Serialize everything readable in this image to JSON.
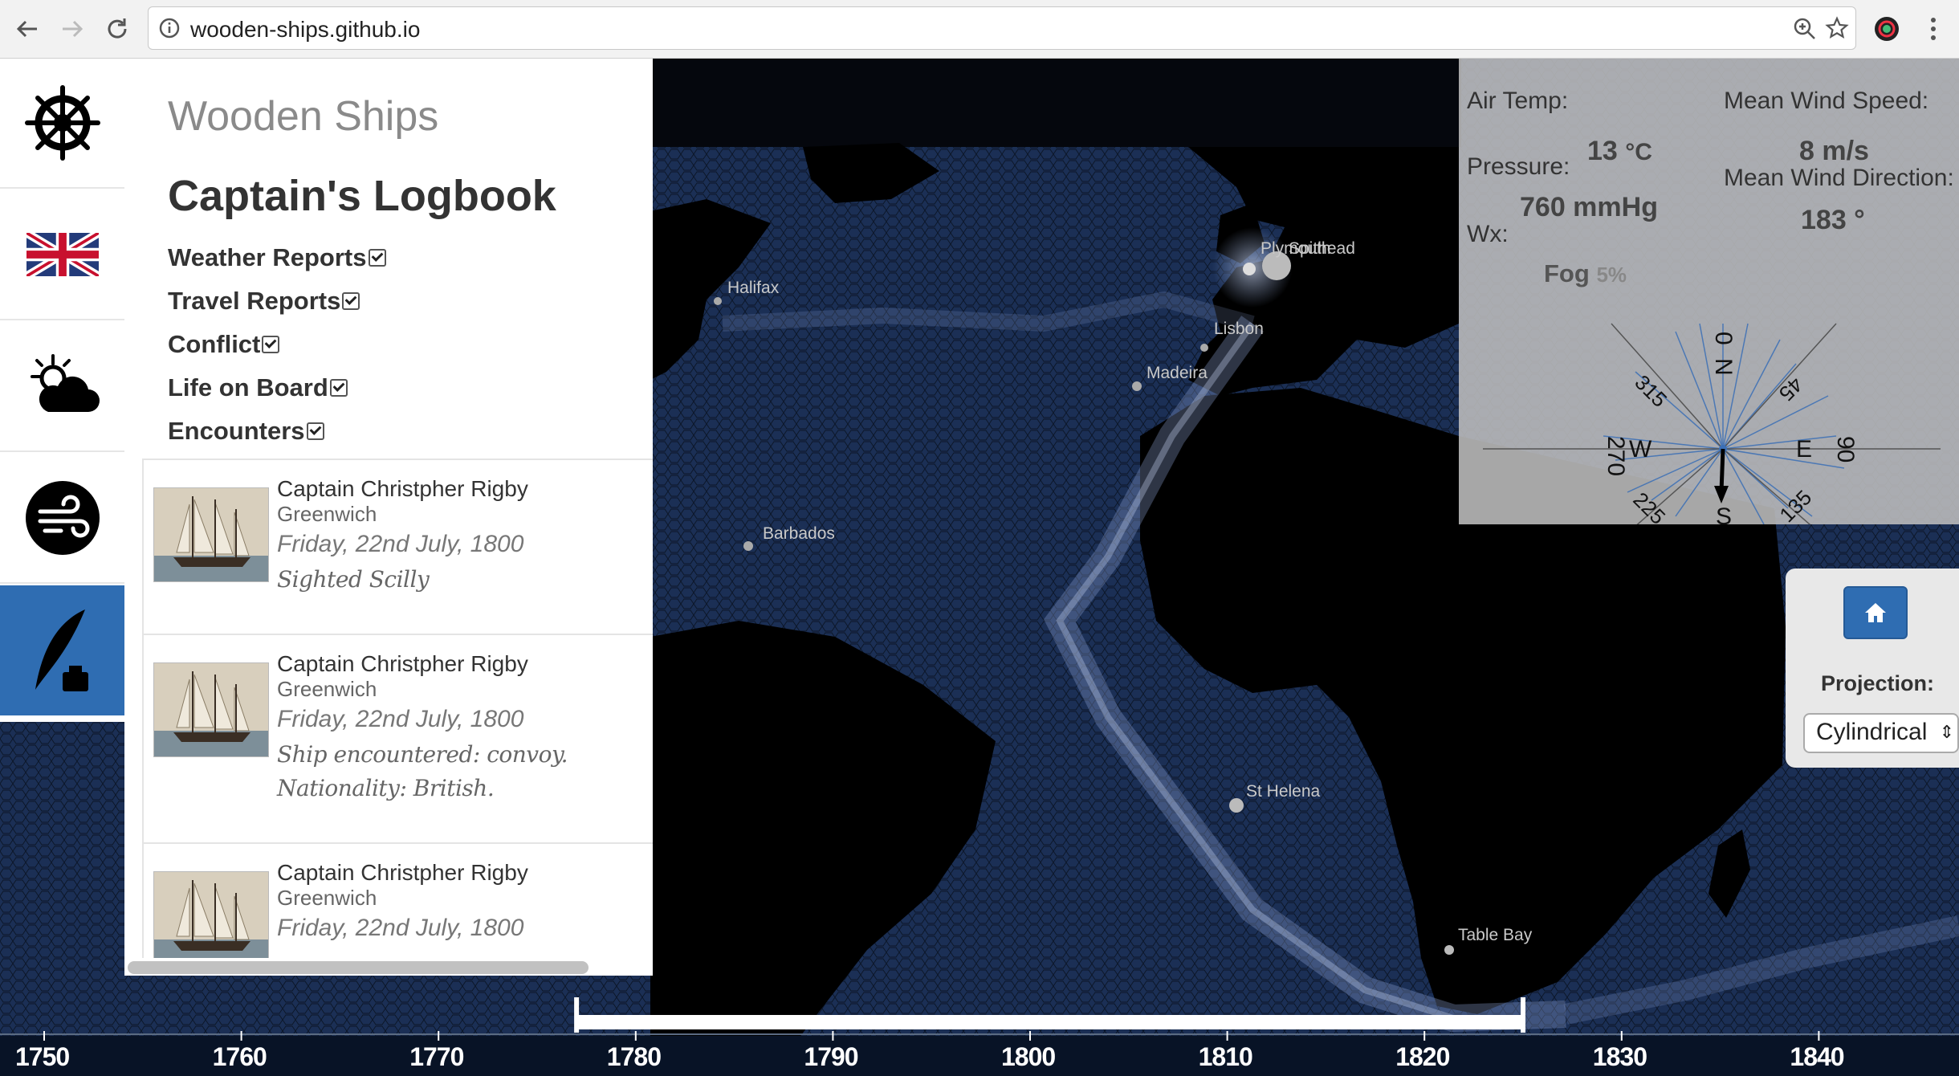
{
  "browser": {
    "url": "wooden-ships.github.io"
  },
  "sidebar": {
    "app_title": "Wooden Ships",
    "logbook_title": "Captain's Logbook",
    "tabs": [
      "ship-wheel-icon",
      "uk-flag-icon",
      "weather-icon",
      "wind-icon",
      "quill-ink-icon"
    ],
    "active_tab": "quill-ink-icon",
    "filters": [
      {
        "label": "Weather Reports",
        "checked": true
      },
      {
        "label": "Travel Reports",
        "checked": true
      },
      {
        "label": "Conflict",
        "checked": true
      },
      {
        "label": "Life on Board",
        "checked": true
      },
      {
        "label": "Encounters",
        "checked": true
      }
    ],
    "entries": [
      {
        "captain": "Captain Christpher Rigby",
        "place": "Greenwich",
        "date": "Friday, 22nd July, 1800",
        "note": "Sighted Scilly",
        "note2": ""
      },
      {
        "captain": "Captain Christpher Rigby",
        "place": "Greenwich",
        "date": "Friday, 22nd July, 1800",
        "note": "Ship encountered: convoy.",
        "note2": "Nationality: British."
      },
      {
        "captain": "Captain Christpher Rigby",
        "place": "Greenwich",
        "date": "Friday, 22nd July, 1800",
        "note": "",
        "note2": ""
      }
    ]
  },
  "map": {
    "places": [
      {
        "name": "Halifax"
      },
      {
        "name": "Plymouth"
      },
      {
        "name": "Spithead"
      },
      {
        "name": "Lisbon"
      },
      {
        "name": "Madeira"
      },
      {
        "name": "Barbados"
      },
      {
        "name": "St Helena"
      },
      {
        "name": "Table Bay"
      }
    ]
  },
  "weather": {
    "air_temp_label": "Air Temp:",
    "air_temp_value": "13",
    "air_temp_unit": "°C",
    "pressure_label": "Pressure:",
    "pressure_value": "760 mmHg",
    "wx_label": "Wx:",
    "wx_value": "Fog",
    "wx_pct": "5%",
    "wind_speed_label": "Mean Wind Speed:",
    "wind_speed_value": "8 m/s",
    "wind_dir_label": "Mean Wind Direction:",
    "wind_dir_value": "183 °",
    "compass": {
      "n": "N",
      "n_deg": "0",
      "e": "E",
      "e_deg": "90",
      "s": "S",
      "s_deg": "180",
      "w": "W",
      "w_deg": "270",
      "ne_deg": "45",
      "se_deg": "135",
      "sw_deg": "225",
      "nw_deg": "315"
    }
  },
  "projection": {
    "label": "Projection:",
    "selected": "Cylindrical"
  },
  "timeline": {
    "years": [
      "1750",
      "1760",
      "1770",
      "1780",
      "1790",
      "1800",
      "1810",
      "1820",
      "1830",
      "1840"
    ],
    "selection_start_year": 1777,
    "selection_end_year": 1825
  },
  "colors": {
    "accent": "#2f6db2",
    "ocean": "#1b2f55",
    "track": "#8ea6d6"
  }
}
